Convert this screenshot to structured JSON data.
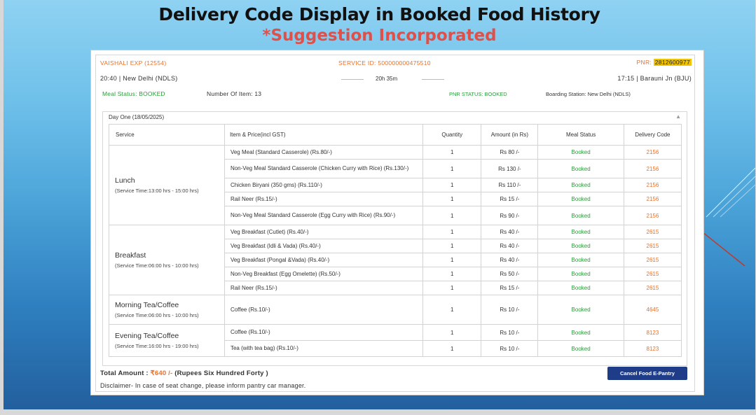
{
  "slide": {
    "title": "Delivery Code Display in Booked Food History",
    "subtitle": "*Suggestion Incorporated"
  },
  "header": {
    "train": "VAISHALI EXP (12554)",
    "service_label": "SERVICE ID: 500000000475510",
    "pnr_label": "PNR:",
    "pnr_value": "2812600977",
    "departure": "20:40 | New Delhi (NDLS)",
    "duration": "20h 35m",
    "arrival": "17:15 | Barauni Jn (BJU)",
    "meal_status": "Meal Status: BOOKED",
    "item_count": "Number Of Item: 13",
    "pnr_status": "PNR STATUS: BOOKED",
    "boarding": "Boarding Station: New Delhi (NDLS)"
  },
  "day": {
    "label": "Day One (18/05/2025)",
    "collapse_icon": "chevron-up-icon"
  },
  "table": {
    "columns": [
      "Service",
      "Item & Price(incl GST)",
      "Quantity",
      "Amount (in Rs)",
      "Meal Status",
      "Delivery Code"
    ],
    "groups": [
      {
        "name": "Lunch",
        "time": "(Service Time:13:00 hrs - 15:00 hrs)",
        "rows": [
          {
            "item": "Veg Meal (Standard Casserole) (Rs.80/-)",
            "qty": "1",
            "amount": "Rs 80 /-",
            "status": "Booked",
            "code": "2156"
          },
          {
            "item": "Non-Veg Meal Standard Casserole (Chicken Curry with Rice) (Rs.130/-)",
            "qty": "1",
            "amount": "Rs 130 /-",
            "status": "Booked",
            "code": "2156"
          },
          {
            "item": "Chicken Biryani (350 gms) (Rs.110/-)",
            "qty": "1",
            "amount": "Rs 110 /-",
            "status": "Booked",
            "code": "2156"
          },
          {
            "item": "Rail Neer (Rs.15/-)",
            "qty": "1",
            "amount": "Rs 15 /-",
            "status": "Booked",
            "code": "2156"
          },
          {
            "item": "Non-Veg Meal Standard Casserole (Egg Curry with Rice) (Rs.90/-)",
            "qty": "1",
            "amount": "Rs 90 /-",
            "status": "Booked",
            "code": "2156"
          }
        ]
      },
      {
        "name": "Breakfast",
        "time": "(Service Time:06:00 hrs - 10:00 hrs)",
        "rows": [
          {
            "item": "Veg Breakfast (Cutlet) (Rs.40/-)",
            "qty": "1",
            "amount": "Rs 40 /-",
            "status": "Booked",
            "code": "2615"
          },
          {
            "item": "Veg Breakfast (Idli & Vada) (Rs.40/-)",
            "qty": "1",
            "amount": "Rs 40 /-",
            "status": "Booked",
            "code": "2615"
          },
          {
            "item": "Veg Breakfast (Pongal &Vada) (Rs.40/-)",
            "qty": "1",
            "amount": "Rs 40 /-",
            "status": "Booked",
            "code": "2615"
          },
          {
            "item": "Non-Veg Breakfast (Egg Omelette) (Rs.50/-)",
            "qty": "1",
            "amount": "Rs 50 /-",
            "status": "Booked",
            "code": "2615"
          },
          {
            "item": "Rail Neer (Rs.15/-)",
            "qty": "1",
            "amount": "Rs 15 /-",
            "status": "Booked",
            "code": "2615"
          }
        ]
      },
      {
        "name": "Morning Tea/Coffee",
        "time": "(Service Time:06:00 hrs - 10:00 hrs)",
        "rows": [
          {
            "item": "Coffee (Rs.10/-)",
            "qty": "1",
            "amount": "Rs 10 /-",
            "status": "Booked",
            "code": "4645"
          }
        ]
      },
      {
        "name": "Evening Tea/Coffee",
        "time": "(Service Time:16:00 hrs - 19:00 hrs)",
        "rows": [
          {
            "item": "Coffee (Rs.10/-)",
            "qty": "1",
            "amount": "Rs 10 /-",
            "status": "Booked",
            "code": "8123"
          },
          {
            "item": "Tea (with tea bag) (Rs.10/-)",
            "qty": "1",
            "amount": "Rs 10 /-",
            "status": "Booked",
            "code": "8123"
          }
        ]
      }
    ]
  },
  "footer": {
    "total_label": "Total Amount :",
    "total_value": "₹640 /-",
    "total_words": "(Rupees Six Hundred Forty )",
    "disclaimer": "Disclaimer- In case of seat change, please inform pantry car manager.",
    "cancel_button": "Cancel Food E-Pantry"
  },
  "colors": {
    "accent_orange": "#e8702a",
    "status_green": "#2a9a3a",
    "button_blue": "#1f3c88",
    "pnr_highlight": "#f2c400",
    "subtitle_red": "#e0504a"
  }
}
